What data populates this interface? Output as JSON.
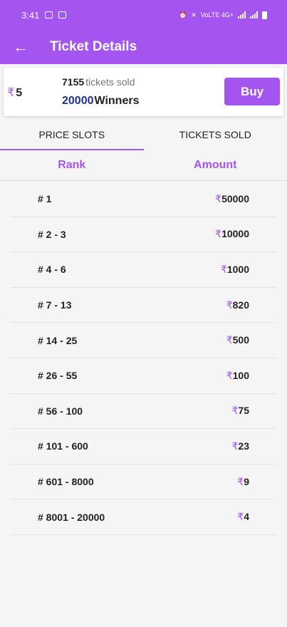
{
  "status_bar": {
    "time": "3:41",
    "network": "VoLTE 4G+"
  },
  "app_bar": {
    "back_icon": "arrow-left-icon",
    "title": "Ticket Details"
  },
  "ticket": {
    "currency": "₹",
    "price": "5",
    "tickets_sold_count": "7155",
    "tickets_sold_label": "tickets sold",
    "winners_count": "20000",
    "winners_label": "Winners",
    "buy_label": "Buy"
  },
  "tabs": [
    {
      "label": "PRICE SLOTS",
      "active": true
    },
    {
      "label": "TICKETS SOLD",
      "active": false
    }
  ],
  "table": {
    "rank_header": "Rank",
    "amount_header": "Amount",
    "rows": [
      {
        "rank": "# 1",
        "currency": "₹",
        "amount": "50000"
      },
      {
        "rank": "# 2 - 3",
        "currency": "₹",
        "amount": "10000"
      },
      {
        "rank": "# 4 - 6",
        "currency": "₹",
        "amount": "1000"
      },
      {
        "rank": "# 7 - 13",
        "currency": "₹",
        "amount": "820"
      },
      {
        "rank": "# 14 - 25",
        "currency": "₹",
        "amount": "500"
      },
      {
        "rank": "# 26 - 55",
        "currency": "₹",
        "amount": "100"
      },
      {
        "rank": "# 56 - 100",
        "currency": "₹",
        "amount": "75"
      },
      {
        "rank": "# 101 - 600",
        "currency": "₹",
        "amount": "23"
      },
      {
        "rank": "# 601 - 8000",
        "currency": "₹",
        "amount": "9"
      },
      {
        "rank": "# 8001 - 20000",
        "currency": "₹",
        "amount": "4"
      }
    ]
  },
  "colors": {
    "accent": "#a455f0",
    "winners": "#1c2f9b"
  }
}
